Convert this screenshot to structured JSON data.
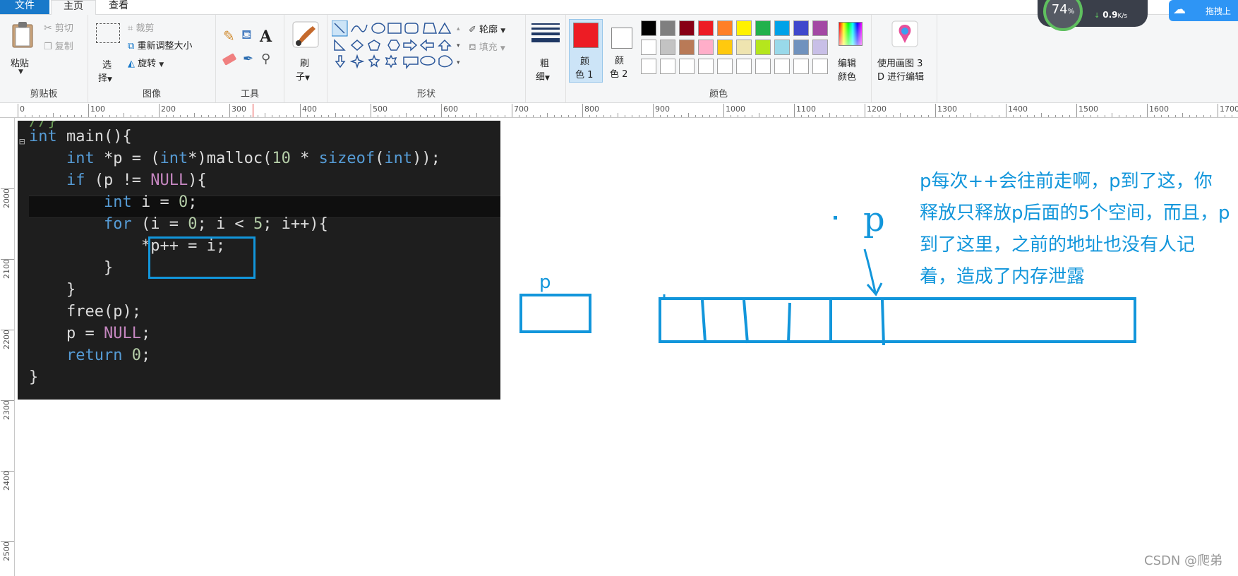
{
  "menu": {
    "file": "文件",
    "home": "主页",
    "view": "查看"
  },
  "clipboard": {
    "paste": "粘贴",
    "cut": "剪切",
    "copy": "复制",
    "group_label": "剪贴板"
  },
  "image": {
    "select_line1": "选",
    "select_line2": "择",
    "crop": "裁剪",
    "resize": "重新调整大小",
    "rotate": "旋转",
    "group_label": "图像"
  },
  "tools": {
    "group_label": "工具",
    "text_icon": "A"
  },
  "brush": {
    "line1": "刷",
    "line2": "子"
  },
  "shapes": {
    "outline": "轮廓",
    "fill": "填充",
    "group_label": "形状"
  },
  "size": {
    "line1": "粗",
    "line2": "细"
  },
  "colors": {
    "color1_line1": "颜",
    "color1_line2": "色 1",
    "color2_line1": "颜",
    "color2_line2": "色 2",
    "edit_line1": "编辑",
    "edit_line2": "颜色",
    "group_label": "颜色",
    "color1_hex": "#ed1c24",
    "color2_hex": "#ffffff",
    "palette_row1": [
      "#000000",
      "#7f7f7f",
      "#880015",
      "#ed1c24",
      "#ff7f27",
      "#fff200",
      "#22b14c",
      "#00a2e8",
      "#3f48cc",
      "#a349a4"
    ],
    "palette_row2": [
      "#ffffff",
      "#c3c3c3",
      "#b97a57",
      "#ffaec9",
      "#ffc90e",
      "#efe4b0",
      "#b5e61d",
      "#99d9ea",
      "#7092be",
      "#c8bfe7"
    ]
  },
  "paint3d": {
    "line1": "使用画图 3",
    "line2": "D 进行编辑"
  },
  "overlay": {
    "percent": "74",
    "percent_sign": "%",
    "speed": "0.9",
    "speed_unit": "K/s",
    "cloud_label": "拖拽上"
  },
  "ruler": {
    "h_labels": [
      "0",
      "100",
      "200",
      "300",
      "400",
      "500",
      "600",
      "700",
      "800",
      "900",
      "1000",
      "1100",
      "1200",
      "1300",
      "1400",
      "1500",
      "1600",
      "1700"
    ],
    "v_labels": [
      "2000",
      "2100",
      "2200",
      "2300",
      "2400",
      "2500"
    ]
  },
  "code": {
    "line0": "//}",
    "line1_kw": "int",
    "line1_rest": " main(){",
    "line2_kw": "int",
    "line2_a": " *p = (",
    "line2_kw2": "int",
    "line2_b": "*)malloc(",
    "line2_num": "10",
    "line2_c": " * ",
    "line2_kw3": "sizeof",
    "line2_d": "(",
    "line2_kw4": "int",
    "line2_e": "));",
    "line3_kw": "if",
    "line3_a": " (p != ",
    "line3_null": "NULL",
    "line3_b": "){",
    "line4_kw": "int",
    "line4_a": " i = ",
    "line4_num": "0",
    "line4_b": ";",
    "line5_kw": "for",
    "line5_a": " (i = ",
    "line5_num": "0",
    "line5_b": "; i < ",
    "line5_num2": "5",
    "line5_c": "; i++){",
    "line6": "*p++ = i;",
    "line7": "}",
    "line8": "}",
    "line9": "free(p);",
    "line10_a": "p = ",
    "line10_null": "NULL",
    "line10_b": ";",
    "line11_kw": "return",
    "line11_a": " ",
    "line11_num": "0",
    "line11_b": ";",
    "line12": "}"
  },
  "drawing": {
    "p_small": "p",
    "p_big": "p",
    "annotation": "p每次++会往前走啊，p到了这，你释放只释放p后面的5个空间，而且，p到了这里，之前的地址也没有人记着，造成了内存泄露",
    "stroke_color": "#1296db"
  },
  "watermark": "CSDN @爬弟"
}
